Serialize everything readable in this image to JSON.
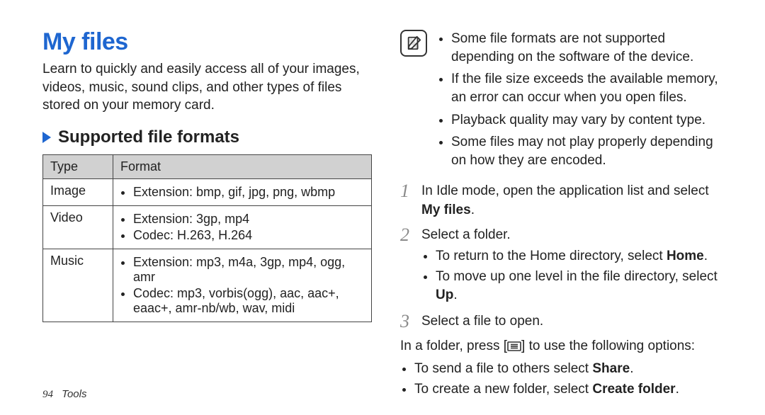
{
  "left": {
    "title": "My files",
    "intro": "Learn to quickly and easily access all of your images, videos, music, sound clips, and other types of files stored on your memory card.",
    "section_heading": "Supported file formats",
    "table": {
      "headers": [
        "Type",
        "Format"
      ],
      "rows": [
        {
          "type": "Image",
          "items": [
            "Extension: bmp, gif, jpg, png, wbmp"
          ]
        },
        {
          "type": "Video",
          "items": [
            "Extension: 3gp, mp4",
            "Codec: H.263, H.264"
          ]
        },
        {
          "type": "Music",
          "items": [
            "Extension: mp3, m4a, 3gp, mp4, ogg, amr",
            "Codec: mp3, vorbis(ogg), aac, aac+, eaac+, amr-nb/wb, wav, midi"
          ]
        }
      ]
    }
  },
  "right": {
    "notes": [
      "Some file formats are not supported depending on the software of the device.",
      "If the file size exceeds the available memory, an error can occur when you open files.",
      "Playback quality may vary by content type.",
      "Some files may not play properly depending on how they are encoded."
    ],
    "steps": [
      {
        "num": "1",
        "text_pre": "In Idle mode, open the application list and select ",
        "bold": "My files",
        "text_post": "."
      },
      {
        "num": "2",
        "text_pre": "Select a folder.",
        "sub": [
          {
            "pre": "To return to the Home directory, select ",
            "bold": "Home",
            "post": "."
          },
          {
            "pre": "To move up one level in the file directory, select ",
            "bold": "Up",
            "post": "."
          }
        ]
      },
      {
        "num": "3",
        "text_pre": "Select a file to open."
      }
    ],
    "after_intro_pre": "In a folder, press [",
    "after_intro_post": "] to use the following options:",
    "after_options": [
      {
        "pre": "To send a file to others select ",
        "bold": "Share",
        "post": "."
      },
      {
        "pre": "To create a new folder, select ",
        "bold": "Create folder",
        "post": "."
      }
    ]
  },
  "footer": {
    "page": "94",
    "section": "Tools"
  }
}
